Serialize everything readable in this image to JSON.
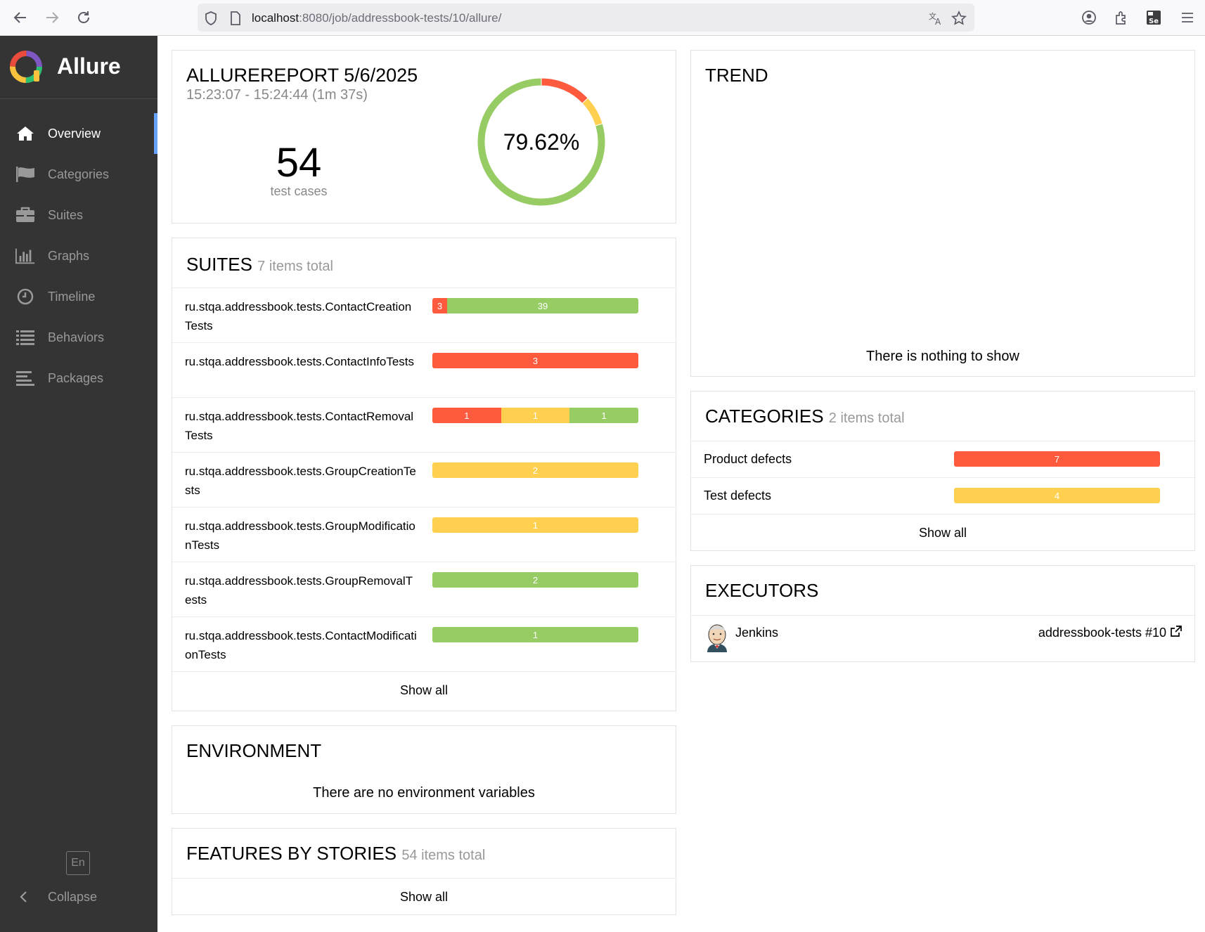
{
  "browser": {
    "url_host": "localhost",
    "url_rest": ":8080/job/addressbook-tests/10/allure/"
  },
  "sidebar": {
    "brand": "Allure",
    "items": [
      {
        "label": "Overview",
        "icon": "home-icon",
        "active": true
      },
      {
        "label": "Categories",
        "icon": "flag-icon"
      },
      {
        "label": "Suites",
        "icon": "briefcase-icon"
      },
      {
        "label": "Graphs",
        "icon": "bar-chart-icon"
      },
      {
        "label": "Timeline",
        "icon": "clock-icon"
      },
      {
        "label": "Behaviors",
        "icon": "list-icon"
      },
      {
        "label": "Packages",
        "icon": "align-left-icon"
      }
    ],
    "language": "En",
    "collapse": "Collapse"
  },
  "summary": {
    "title": "ALLUREREPORT 5/6/2025",
    "time": "15:23:07 - 15:24:44 (1m 37s)",
    "count": "54",
    "count_label": "test cases",
    "percent": "79.62%",
    "donut": {
      "failed": 7,
      "broken": 4,
      "passed": 43
    }
  },
  "suites": {
    "title": "SUITES",
    "subtitle": "7 items total",
    "items": [
      {
        "name": "ru.stqa.addressbook.tests.ContactCreationTests",
        "failed": 3,
        "broken": 0,
        "passed": 39
      },
      {
        "name": "ru.stqa.addressbook.tests.ContactInfoTests",
        "failed": 3,
        "broken": 0,
        "passed": 0
      },
      {
        "name": "ru.stqa.addressbook.tests.ContactRemovalTests",
        "failed": 1,
        "broken": 1,
        "passed": 1
      },
      {
        "name": "ru.stqa.addressbook.tests.GroupCreationTests",
        "failed": 0,
        "broken": 2,
        "passed": 0
      },
      {
        "name": "ru.stqa.addressbook.tests.GroupModificationTests",
        "failed": 0,
        "broken": 1,
        "passed": 0
      },
      {
        "name": "ru.stqa.addressbook.tests.GroupRemovalTests",
        "failed": 0,
        "broken": 0,
        "passed": 2
      },
      {
        "name": "ru.stqa.addressbook.tests.ContactModificationTests",
        "failed": 0,
        "broken": 0,
        "passed": 1
      }
    ],
    "show_all": "Show all"
  },
  "environment": {
    "title": "ENVIRONMENT",
    "empty": "There are no environment variables"
  },
  "features": {
    "title": "FEATURES BY STORIES",
    "subtitle": "54 items total",
    "show_all": "Show all"
  },
  "trend": {
    "title": "TREND",
    "empty": "There is nothing to show"
  },
  "categories": {
    "title": "CATEGORIES",
    "subtitle": "2 items total",
    "items": [
      {
        "name": "Product defects",
        "value": 7,
        "status": "failed"
      },
      {
        "name": "Test defects",
        "value": 4,
        "status": "broken"
      }
    ],
    "show_all": "Show all"
  },
  "executors": {
    "title": "EXECUTORS",
    "name": "Jenkins",
    "build": "addressbook-tests #10"
  },
  "colors": {
    "failed": "#fd5a3e",
    "broken": "#ffd050",
    "passed": "#97cc64",
    "sidebar": "#343434",
    "active_marker": "#66a3ff"
  }
}
